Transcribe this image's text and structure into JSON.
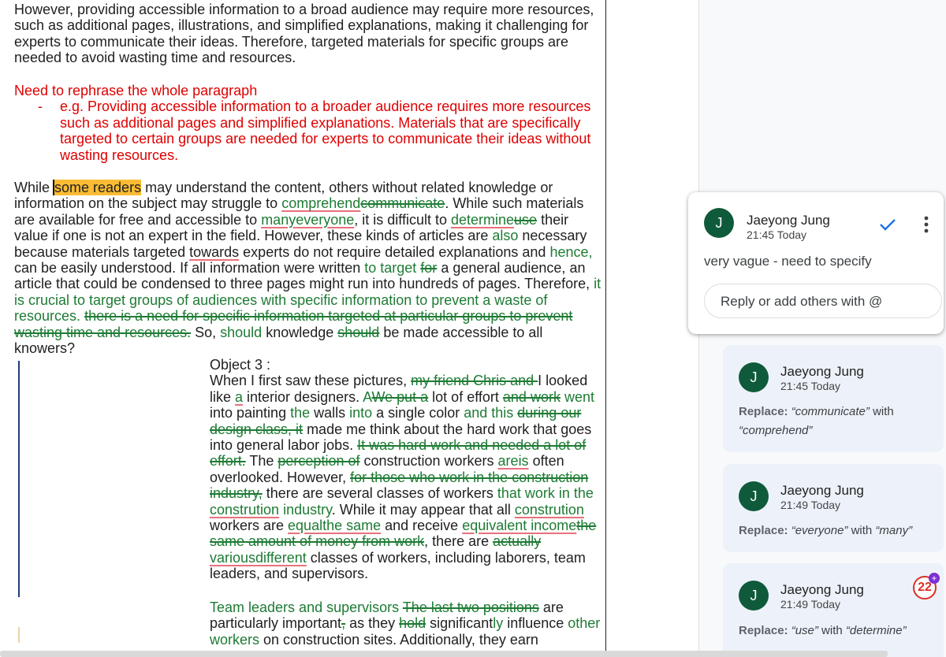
{
  "doc": {
    "para1": "However, providing accessible information to a broad audience may require more resources, such as additional pages, illustrations, and simplified explanations, making it challenging for experts to communicate their ideas. Therefore, targeted materials for specific groups are needed to avoid wasting time and resources.",
    "note_title": "Need to rephrase the whole paragraph",
    "note_bullet": "-",
    "note_example": "e.g. Providing accessible information to a broader audience requires more resources such as additional pages and simplified explanations. Materials that are specifically targeted to certain groups are needed for experts to communicate their ideas without wasting resources.",
    "p2": {
      "s1": "While ",
      "s2": "some readers",
      "s3": " may understand the content, others without related knowledge or information on the subject may struggle to ",
      "s4": "comprehend",
      "s5": "communicate",
      "s6": ". While such materials are available for free and accessible to ",
      "s7": "many",
      "s8": "everyone",
      "s9": ", it is difficult to ",
      "s10": "determine",
      "s11": "use",
      "s12": " their value if one is not an expert in the field. However, these kinds of articles are ",
      "s13": "also",
      "s14": " necessary because materials targeted ",
      "s15": "towards",
      "s16": " experts do not require detailed explanations and ",
      "s17": "hence,",
      "s18": " can be easily understood. If all information were written ",
      "s19": "to target",
      "s20": " ",
      "s21": "for",
      "s22": " a general audience, an article that could be condensed to three pages might run into hundreds of pages. Therefore, ",
      "s23": "it is crucial to target groups of audiences with specific information to prevent a waste of resources.",
      "s24": " ",
      "s25": "there is a need for specific information targeted at particular groups to prevent wasting time and resources.",
      "s26": " So, ",
      "s27": "should",
      "s28": "  knowledge ",
      "s29": "should",
      "s30": " be made accessible to all knowers?"
    },
    "obj": {
      "title": "Object 3 :",
      "a1": "When I first saw these pictures, ",
      "a2": "my friend Chris and ",
      "a3": "I looked like ",
      "a4": "a",
      "a5": " interior designers. ",
      "a6": "A",
      "a7": "We put a",
      "a8": " lot of effort ",
      "a9": "and work",
      "a10": " ",
      "a11": "went",
      "a12": " into painting ",
      "a13": "the",
      "a14": " walls ",
      "a15": "into",
      "a16": " a single color ",
      "a17": "and this",
      "a18": " ",
      "a19": "during our design class, it",
      "a20": " made me think about the hard work that goes into general labor jobs. ",
      "a21": "It was hard work and needed a lot of effort.",
      "a22": " The ",
      "a23": "perception of",
      "a24": " construction workers ",
      "a25": "are",
      "a26": "is",
      "a27": " often overlooked. However, ",
      "a28": "for those who work in the construction industry,",
      "a29": " there are several classes of workers ",
      "a30": "that work in the ",
      "a31": "constrution",
      "a32": " industry",
      "a33": ". While it may appear that all ",
      "a34": "constrution",
      "a35": " workers are ",
      "a36": "equal",
      "a37": "the same",
      "a38": " and receive ",
      "a39": "equivalent income",
      "a40": "the same amount of money from work",
      "a41": ", there are ",
      "a42": "actually",
      "a43": " ",
      "a44": "various",
      "a45": "different",
      "a46": " classes of workers, including laborers, team leaders, and supervisors."
    },
    "obj2": {
      "b1": "Team leaders and supervisors",
      "b2": " ",
      "b3": "The last two positions",
      "b4": " are particularly important",
      "b5": ",",
      "b6": " as they ",
      "b7": "hold",
      "b8": " significant",
      "b9": "ly",
      "b10": " influence ",
      "b11": "other workers",
      "b12": " on construction sites. Additionally, they earn"
    }
  },
  "comment": {
    "avatar": "J",
    "author": "Jaeyong Jung",
    "time": "21:45 Today",
    "resolve_icon": "check-icon",
    "more_icon": "more-vert-icon",
    "body": "very vague - need to specify",
    "reply_placeholder": "Reply or add others with @"
  },
  "suggestions": [
    {
      "avatar": "J",
      "author": "Jaeyong Jung",
      "time": "21:45 Today",
      "label": "Replace:",
      "from": "“communicate”",
      "mid": " with ",
      "to": "“comprehend”"
    },
    {
      "avatar": "J",
      "author": "Jaeyong Jung",
      "time": "21:49 Today",
      "label": "Replace:",
      "from": "“everyone”",
      "mid": " with ",
      "to": "“many”"
    },
    {
      "avatar": "J",
      "author": "Jaeyong Jung",
      "time": "21:49 Today",
      "label": "Replace:",
      "from": "“use”",
      "mid": " with ",
      "to": "“determine”"
    }
  ],
  "badge": {
    "count": "22",
    "icon": "add-badge-icon"
  },
  "colors": {
    "suggestion_green": "#1e7b34",
    "note_red": "#e00000",
    "highlight": "#fbbc33",
    "avatar": "#0f5a3a",
    "check": "#1a73e8"
  }
}
